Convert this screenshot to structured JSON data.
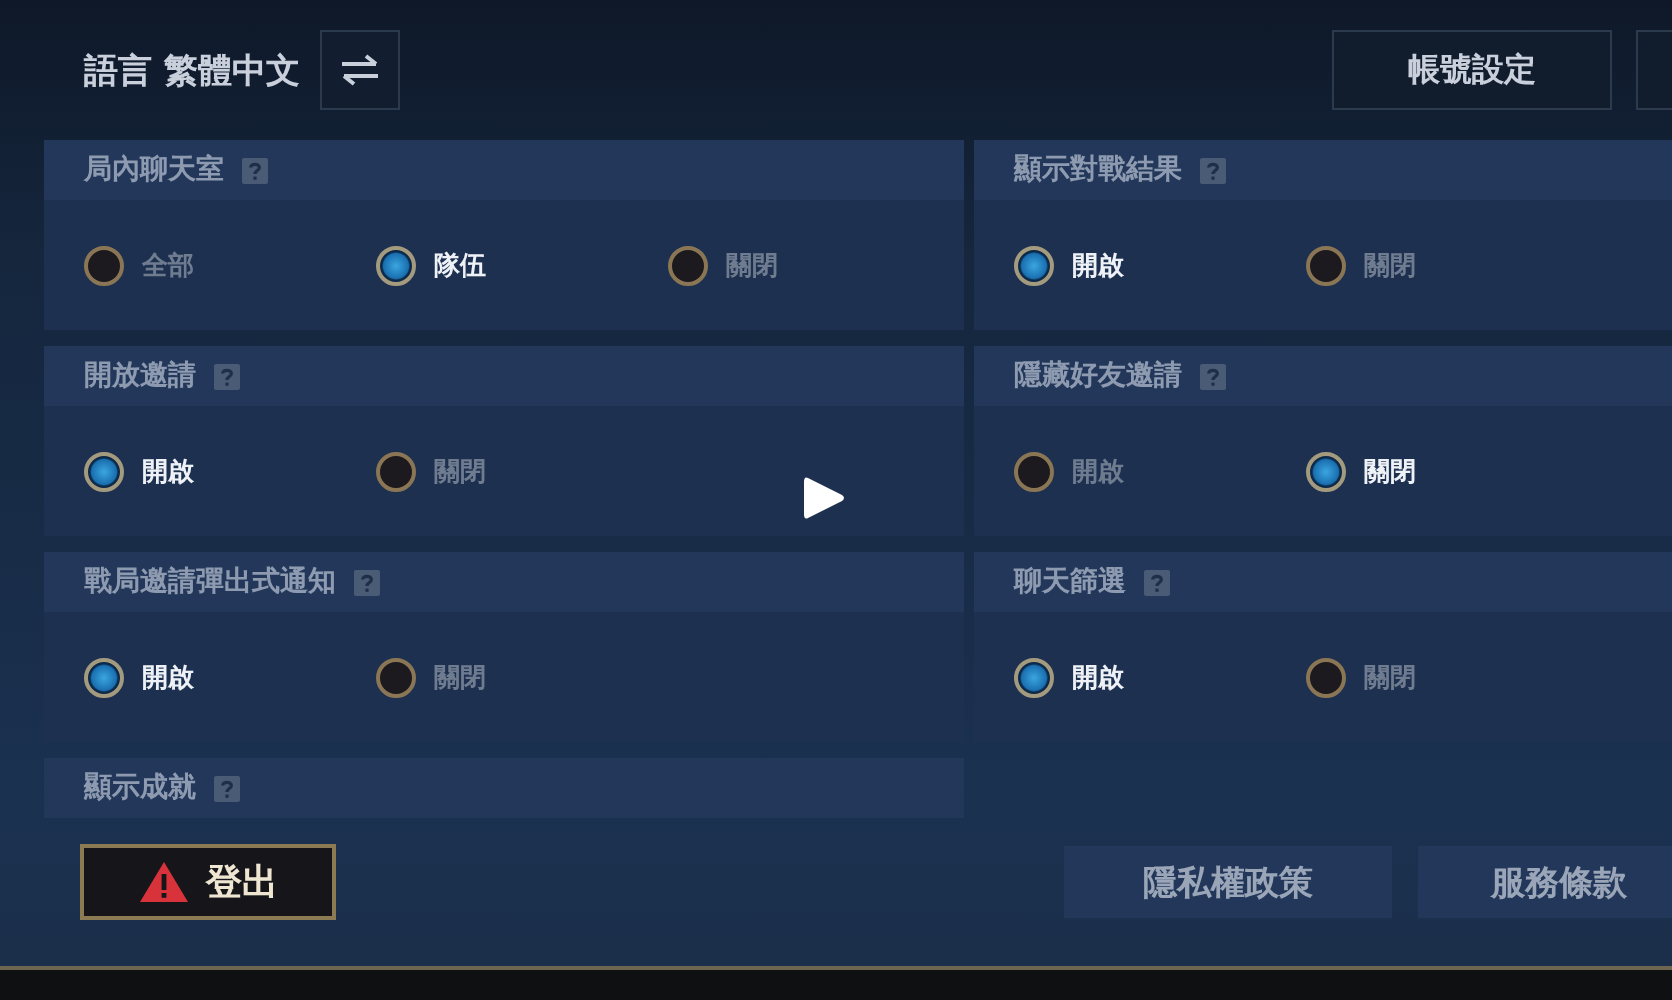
{
  "language": {
    "label": "語言",
    "value": "繁體中文"
  },
  "account_button": "帳號設定",
  "sections": [
    {
      "title": "局內聊天室",
      "options": [
        {
          "label": "全部",
          "selected": false
        },
        {
          "label": "隊伍",
          "selected": true
        },
        {
          "label": "關閉",
          "selected": false
        }
      ]
    },
    {
      "title": "顯示對戰結果",
      "options": [
        {
          "label": "開啟",
          "selected": true
        },
        {
          "label": "關閉",
          "selected": false
        }
      ]
    },
    {
      "title": "開放邀請",
      "options": [
        {
          "label": "開啟",
          "selected": true
        },
        {
          "label": "關閉",
          "selected": false
        }
      ]
    },
    {
      "title": "隱藏好友邀請",
      "options": [
        {
          "label": "開啟",
          "selected": false
        },
        {
          "label": "關閉",
          "selected": true
        }
      ]
    },
    {
      "title": "戰局邀請彈出式通知",
      "options": [
        {
          "label": "開啟",
          "selected": true
        },
        {
          "label": "關閉",
          "selected": false
        }
      ]
    },
    {
      "title": "聊天篩選",
      "options": [
        {
          "label": "開啟",
          "selected": true
        },
        {
          "label": "關閉",
          "selected": false
        }
      ]
    },
    {
      "title": "顯示成就"
    }
  ],
  "footer": {
    "logout": "登出",
    "links": [
      "隱私權政策",
      "服務條款"
    ]
  }
}
